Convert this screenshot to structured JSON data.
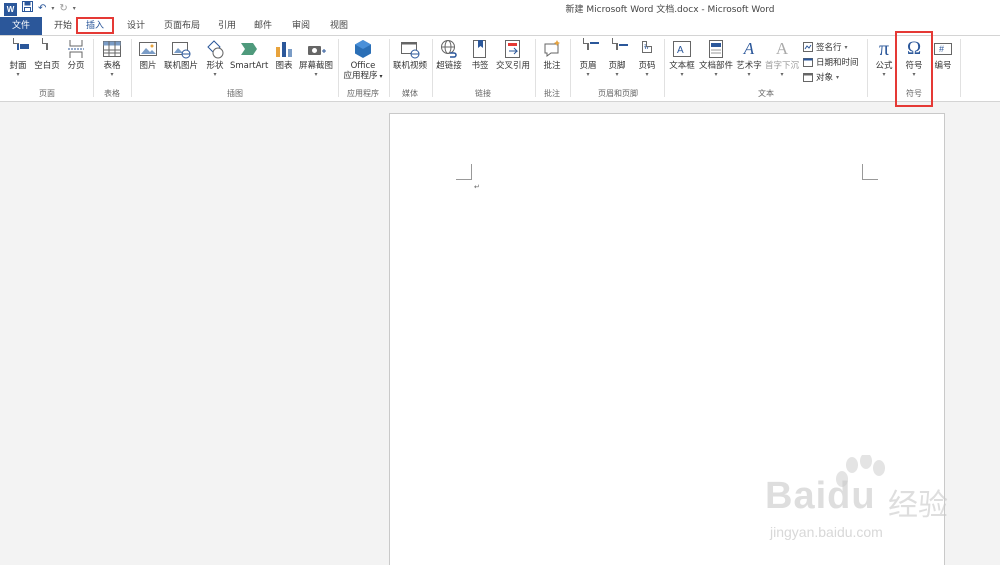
{
  "window": {
    "title": "新建 Microsoft Word 文档.docx - Microsoft Word",
    "qat": {
      "logo": "W",
      "save_icon": "save-icon",
      "undo_icon": "undo-icon",
      "redo_icon": "redo-icon",
      "customize_icon": "customize-qat-icon"
    }
  },
  "tabs": {
    "file": "文件",
    "items": [
      "开始",
      "插入",
      "设计",
      "页面布局",
      "引用",
      "邮件",
      "审阅",
      "视图"
    ],
    "active": "插入"
  },
  "ribbon": {
    "groups": {
      "pages": {
        "label": "页面",
        "cover": "封面",
        "blank": "空白页",
        "break": "分页"
      },
      "tables": {
        "label": "表格",
        "table": "表格"
      },
      "illustrations": {
        "label": "插图",
        "picture": "图片",
        "online_picture": "联机图片",
        "shapes": "形状",
        "smartart": "SmartArt",
        "chart": "图表",
        "screenshot": "屏幕截图"
      },
      "apps": {
        "label": "应用程序",
        "office_line1": "Office",
        "office_line2": "应用程序"
      },
      "media": {
        "label": "媒体",
        "online_video": "联机视频"
      },
      "links": {
        "label": "链接",
        "hyperlink": "超链接",
        "bookmark": "书签",
        "cross_ref": "交叉引用"
      },
      "comments": {
        "label": "批注",
        "comment": "批注"
      },
      "header_footer": {
        "label": "页眉和页脚",
        "header": "页眉",
        "footer": "页脚",
        "page_number": "页码"
      },
      "text": {
        "label": "文本",
        "textbox": "文本框",
        "quick_parts": "文档部件",
        "wordart": "艺术字",
        "dropcap": "首字下沉",
        "signature": "签名行",
        "datetime": "日期和时间",
        "object": "对象"
      },
      "symbols": {
        "label": "符号",
        "equation": "公式",
        "symbol": "符号",
        "number": "编号"
      }
    }
  },
  "document": {
    "paragraph_mark": "↵"
  },
  "watermark": {
    "brand": "Bai",
    "brand2": "du",
    "cn": "经验",
    "url": "jingyan.baidu.com"
  },
  "colors": {
    "accent": "#2b579a",
    "highlight": "#e53935"
  }
}
